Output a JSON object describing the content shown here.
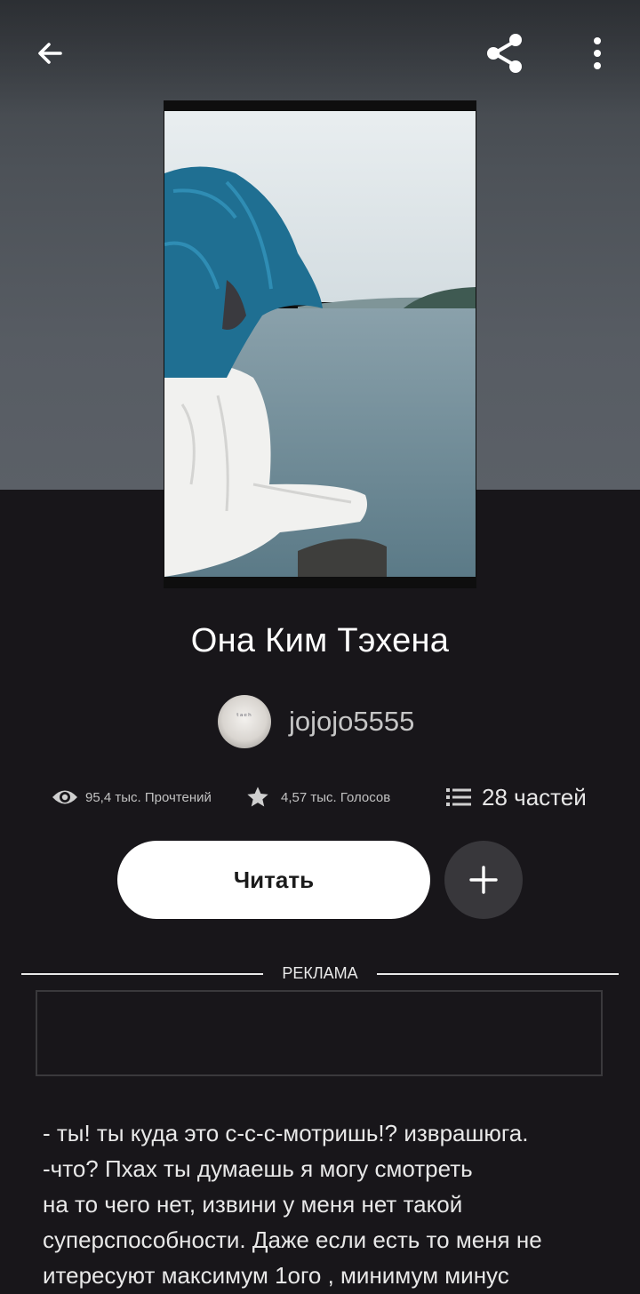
{
  "header": {
    "back_icon": "arrow-left-icon",
    "share_icon": "share-icon",
    "more_icon": "more-vertical-icon"
  },
  "book": {
    "title": "Она Ким Тэхена",
    "author": "jojojo5555",
    "avatar_text": "ᵗᵃᵉʰ"
  },
  "stats": {
    "reads": "95,4 тыс. Прочтений",
    "votes": "4,57 тыс. Голосов",
    "parts": "28 частей"
  },
  "actions": {
    "read_label": "Читать",
    "add_icon": "plus-icon"
  },
  "ad": {
    "label": "РЕКЛАМА"
  },
  "description": {
    "lines": [
      "- ты! ты куда это с-с-с-мотришь!? изврашюга.",
      "-что? Пхах ты думаешь я могу смотреть",
      "на то чего нет, извини у меня нет такой",
      "суперспособности. Даже если есть то меня не",
      "итересуют максимум 1ого , минимум минус"
    ]
  },
  "colors": {
    "background": "#18161a",
    "button_primary": "#ffffff",
    "button_secondary": "#38373b"
  }
}
